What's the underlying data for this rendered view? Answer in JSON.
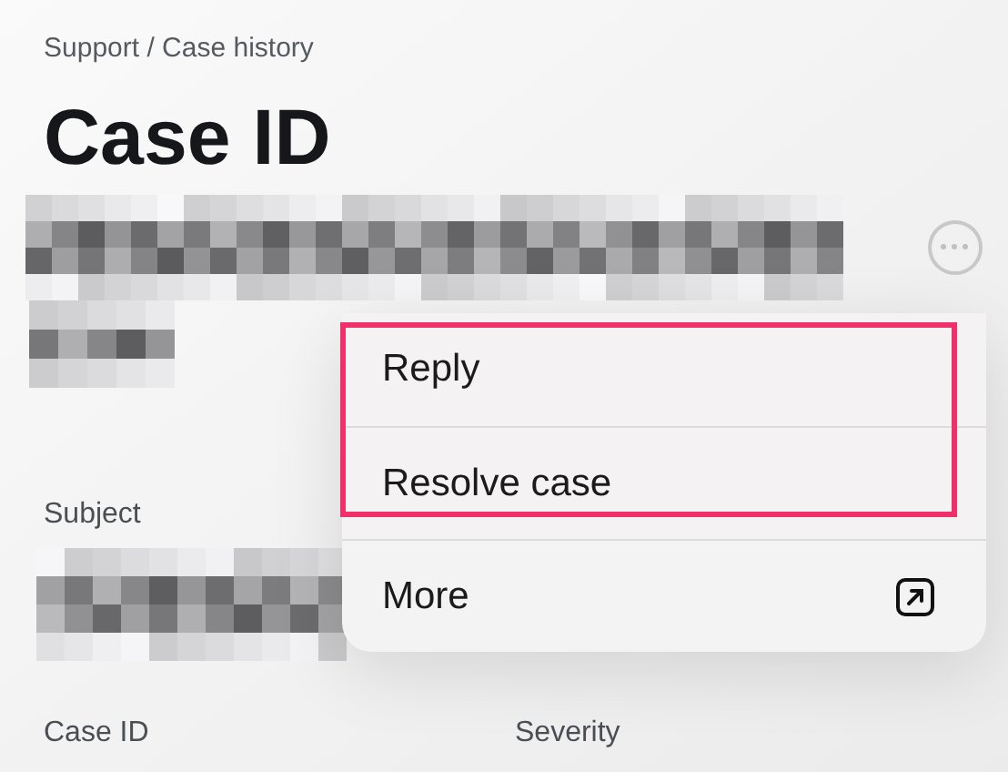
{
  "breadcrumb": "Support / Case history",
  "title": "Case ID",
  "sections": [
    {
      "label": "Subject"
    }
  ],
  "fields": [
    {
      "label": "Case ID"
    },
    {
      "label": "Severity"
    }
  ],
  "menu": {
    "items": [
      {
        "label": "Reply",
        "highlighted": true,
        "kind": "plain"
      },
      {
        "label": "Resolve case",
        "highlighted": true,
        "kind": "plain"
      },
      {
        "label": "More",
        "highlighted": false,
        "kind": "external"
      }
    ]
  }
}
